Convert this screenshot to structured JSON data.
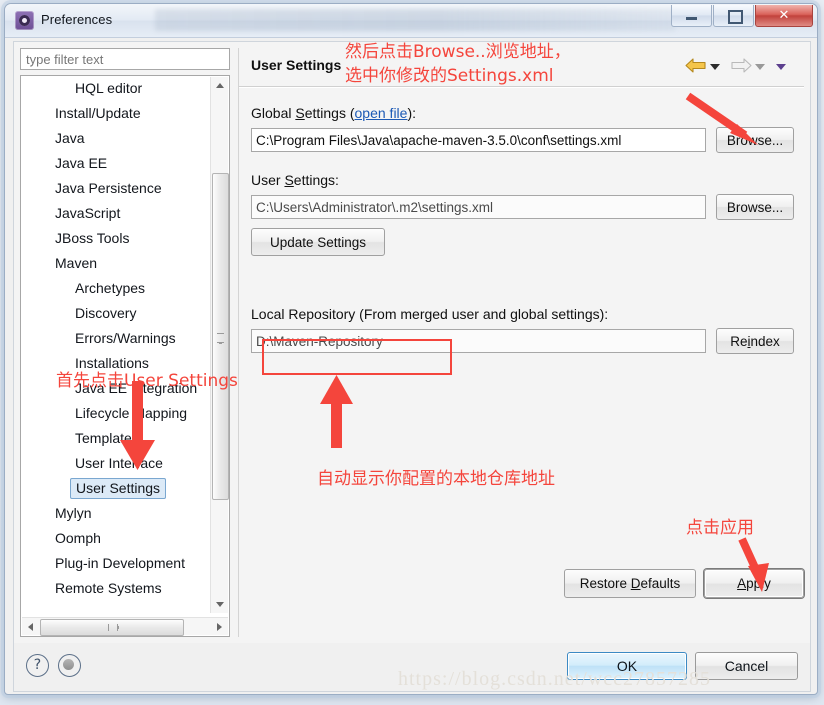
{
  "window": {
    "title": "Preferences",
    "icon": "preferences-gear-icon",
    "controls": {
      "minimize": "minimize",
      "maximize": "maximize",
      "close": "✕"
    }
  },
  "sidebar": {
    "filter_placeholder": "type filter text",
    "items": [
      {
        "label": "HQL editor",
        "indent": 1,
        "twisty": "none",
        "selected": false
      },
      {
        "label": "Install/Update",
        "indent": 0,
        "twisty": "collapsed",
        "selected": false
      },
      {
        "label": "Java",
        "indent": 0,
        "twisty": "collapsed",
        "selected": false
      },
      {
        "label": "Java EE",
        "indent": 0,
        "twisty": "collapsed",
        "selected": false
      },
      {
        "label": "Java Persistence",
        "indent": 0,
        "twisty": "collapsed",
        "selected": false
      },
      {
        "label": "JavaScript",
        "indent": 0,
        "twisty": "collapsed",
        "selected": false
      },
      {
        "label": "JBoss Tools",
        "indent": 0,
        "twisty": "collapsed",
        "selected": false
      },
      {
        "label": "Maven",
        "indent": 0,
        "twisty": "expanded",
        "selected": false
      },
      {
        "label": "Archetypes",
        "indent": 1,
        "twisty": "none",
        "selected": false
      },
      {
        "label": "Discovery",
        "indent": 1,
        "twisty": "none",
        "selected": false
      },
      {
        "label": "Errors/Warnings",
        "indent": 1,
        "twisty": "none",
        "selected": false
      },
      {
        "label": "Installations",
        "indent": 1,
        "twisty": "none",
        "selected": false
      },
      {
        "label": "Java EE Integration",
        "indent": 1,
        "twisty": "none",
        "selected": false
      },
      {
        "label": "Lifecycle Mapping",
        "indent": 1,
        "twisty": "none",
        "selected": false
      },
      {
        "label": "Templates",
        "indent": 1,
        "twisty": "none",
        "selected": false
      },
      {
        "label": "User Interface",
        "indent": 1,
        "twisty": "none",
        "selected": false
      },
      {
        "label": "User Settings",
        "indent": 1,
        "twisty": "none",
        "selected": true
      },
      {
        "label": "Mylyn",
        "indent": 0,
        "twisty": "collapsed",
        "selected": false
      },
      {
        "label": "Oomph",
        "indent": 0,
        "twisty": "collapsed",
        "selected": false
      },
      {
        "label": "Plug-in Development",
        "indent": 0,
        "twisty": "collapsed",
        "selected": false
      },
      {
        "label": "Remote Systems",
        "indent": 0,
        "twisty": "collapsed",
        "selected": false
      }
    ]
  },
  "panel": {
    "title": "User Settings",
    "nav": {
      "back": "back-arrow",
      "back_menu": "dropdown",
      "forward": "forward-arrow",
      "forward_menu": "dropdown",
      "view_menu": "view-menu"
    },
    "global_settings": {
      "label_prefix": "Global ",
      "label_underlined": "S",
      "label_suffix": "ettings (",
      "link": "open file",
      "label_end": "):",
      "value": "C:\\Program Files\\Java\\apache-maven-3.5.0\\conf\\settings.xml",
      "browse": "Browse..."
    },
    "user_settings": {
      "label_prefix": "User ",
      "label_underlined": "S",
      "label_suffix": "ettings:",
      "value": "C:\\Users\\Administrator\\.m2\\settings.xml",
      "browse": "Browse...",
      "update": "Update Settings"
    },
    "local_repository": {
      "label": "Local Repository (From merged user and global settings):",
      "value": "D:\\Maven-Repository",
      "reindex_prefix": "Re",
      "reindex_underlined": "i",
      "reindex_suffix": "ndex"
    },
    "restore_defaults": {
      "prefix": "Restore ",
      "underlined": "D",
      "suffix": "efaults"
    },
    "apply": {
      "prefix": "",
      "underlined": "A",
      "suffix": "pply"
    }
  },
  "footer": {
    "help_icon": "?",
    "info_icon": "info-circle-icon",
    "ok": "OK",
    "cancel": "Cancel"
  },
  "annotations": {
    "header_note_line1": "然后点击Browse..浏览地址，",
    "header_note_line2": "选中你修改的Settings.xml",
    "tree_note": "首先点击User Settings",
    "repo_note": "自动显示你配置的本地仓库地址",
    "apply_note": "点击应用",
    "color": "#f4453c"
  },
  "watermark": "https://blog.csdn.net/wcc27857285"
}
